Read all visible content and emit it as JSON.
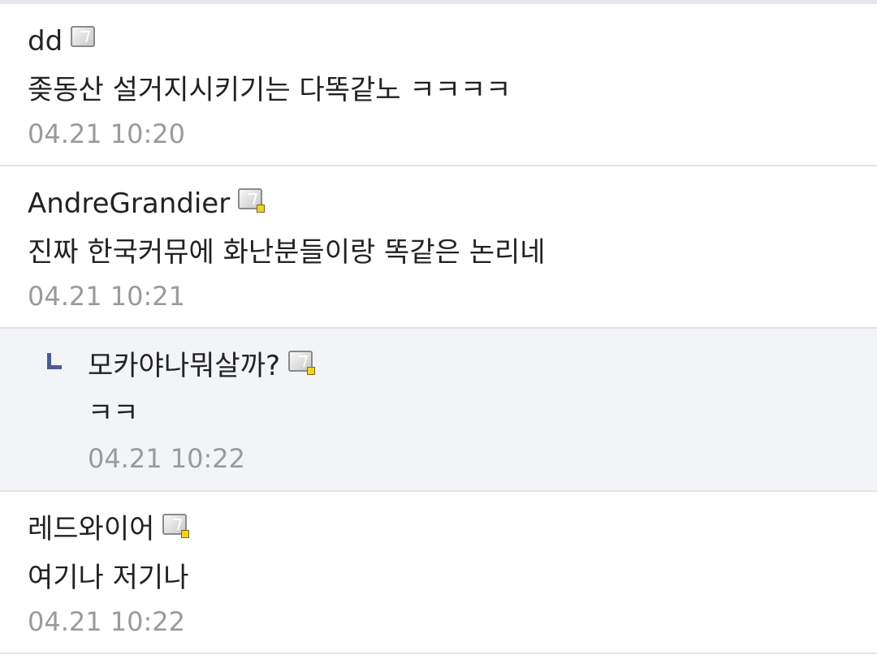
{
  "comments": [
    {
      "author": "dd",
      "badge_icon": "member-level-icon",
      "badge_has_dot": false,
      "text": "좆동산 설거지시키기는 다똑같노 ㅋㅋㅋㅋ",
      "time": "04.21 10:20",
      "is_reply": false
    },
    {
      "author": "AndreGrandier",
      "badge_icon": "member-level-icon",
      "badge_has_dot": true,
      "text": "진짜 한국커뮤에 화난분들이랑 똑같은 논리네",
      "time": "04.21 10:21",
      "is_reply": false
    },
    {
      "author": "모카야나뭐살까?",
      "badge_icon": "member-level-icon",
      "badge_has_dot": true,
      "text": "ㅋㅋ",
      "time": "04.21 10:22",
      "is_reply": true
    },
    {
      "author": "레드와이어",
      "badge_icon": "member-level-icon",
      "badge_has_dot": true,
      "text": "여기나 저기나",
      "time": "04.21 10:22",
      "is_reply": false
    }
  ],
  "colors": {
    "reply_background": "#f2f4f8",
    "reply_arrow": "#4a5a9a",
    "timestamp": "#9a9a9a",
    "divider": "#e3e3e3",
    "badge_dot": "#f2d31b"
  }
}
